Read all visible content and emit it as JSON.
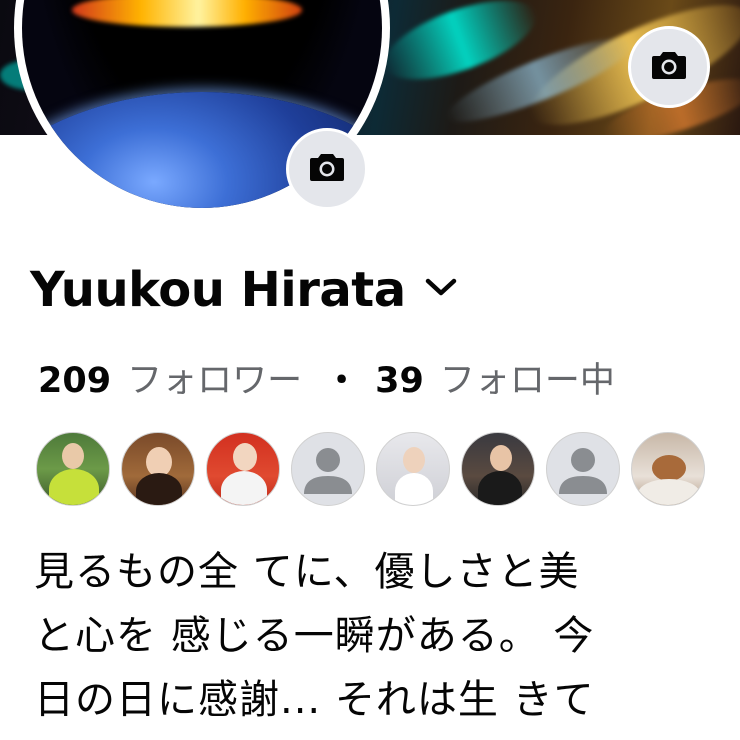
{
  "profile": {
    "name": "Yuukou Hirata",
    "followers_count": "209",
    "followers_label": "フォロワー",
    "separator": "・",
    "following_count": "39",
    "following_label": "フォロー中"
  },
  "bio_lines": [
    "見るもの全 てに、優しさと美",
    "と心を 感じる一瞬がある。 今",
    "日の日に感謝... それは生 きて"
  ],
  "icons": {
    "cover_camera": "camera-icon",
    "avatar_camera": "camera-icon",
    "name_dropdown": "chevron-down-icon",
    "default_avatar": "person-silhouette-icon"
  },
  "friend_avatars": [
    {
      "kind": "photo"
    },
    {
      "kind": "photo"
    },
    {
      "kind": "photo"
    },
    {
      "kind": "default"
    },
    {
      "kind": "photo"
    },
    {
      "kind": "photo"
    },
    {
      "kind": "default"
    },
    {
      "kind": "photo"
    }
  ],
  "colors": {
    "text_primary": "#050505",
    "text_secondary": "#65676b",
    "button_gray": "#e4e6eb"
  }
}
